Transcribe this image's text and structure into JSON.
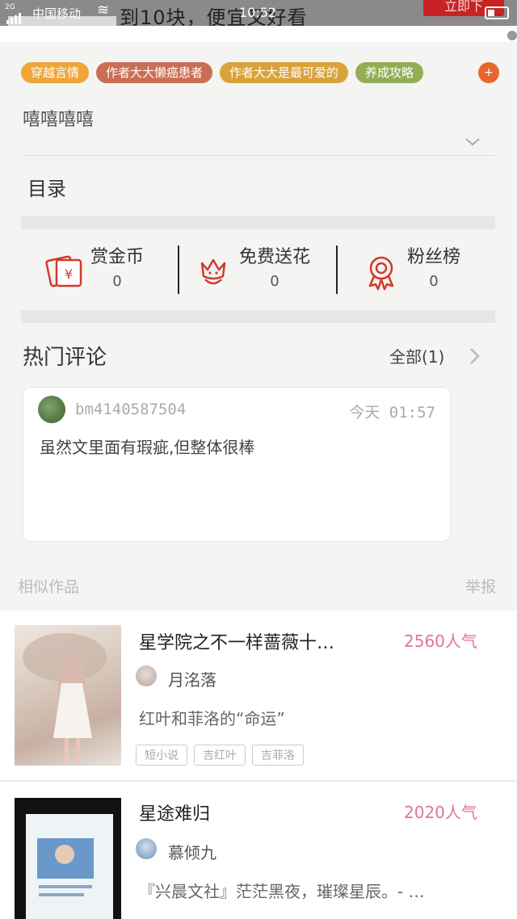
{
  "ad": {
    "text": "到10块，便宜又好看",
    "button": "立即下"
  },
  "status_bar": {
    "network": "2G",
    "carrier": "中国移动",
    "time": "10:52"
  },
  "tags": [
    {
      "label": "穿越言情",
      "color": "#f0a53a"
    },
    {
      "label": "作者大大懒癌患者",
      "color": "#c96f55"
    },
    {
      "label": "作者大大是最可爱的",
      "color": "#d9a33a"
    },
    {
      "label": "养成攻略",
      "color": "#93ad55"
    }
  ],
  "tag_add": "+",
  "summary": "嘻嘻嘻嘻",
  "catalog": "目录",
  "rewards": [
    {
      "label": "赏金币",
      "count": "0",
      "icon": "red-envelope-icon"
    },
    {
      "label": "免费送花",
      "count": "0",
      "icon": "flower-icon"
    },
    {
      "label": "粉丝榜",
      "count": "0",
      "icon": "medal-icon"
    }
  ],
  "hot_comments": {
    "title": "热门评论",
    "all_label": "全部(1)",
    "items": [
      {
        "user": "bm4140587504",
        "time": "今天 01:57",
        "text": "虽然文里面有瑕疵,但整体很棒"
      }
    ]
  },
  "similar": {
    "title": "相似作品",
    "report": "举报"
  },
  "works": [
    {
      "title": "星学院之不一样蔷薇十…",
      "popularity": "2560人气",
      "author": "月洺落",
      "desc": "红叶和菲洛的“命运”",
      "tags": [
        "短小说",
        "吉红叶",
        "吉菲洛"
      ]
    },
    {
      "title": "星途难归",
      "popularity": "2020人气",
      "author": "慕倾九",
      "desc": "『兴晨文社』茫茫黑夜，璀璨星辰。- …",
      "tags": []
    }
  ],
  "colors": {
    "accent_red": "#d23a2a",
    "popularity_pink": "#e0739c"
  }
}
